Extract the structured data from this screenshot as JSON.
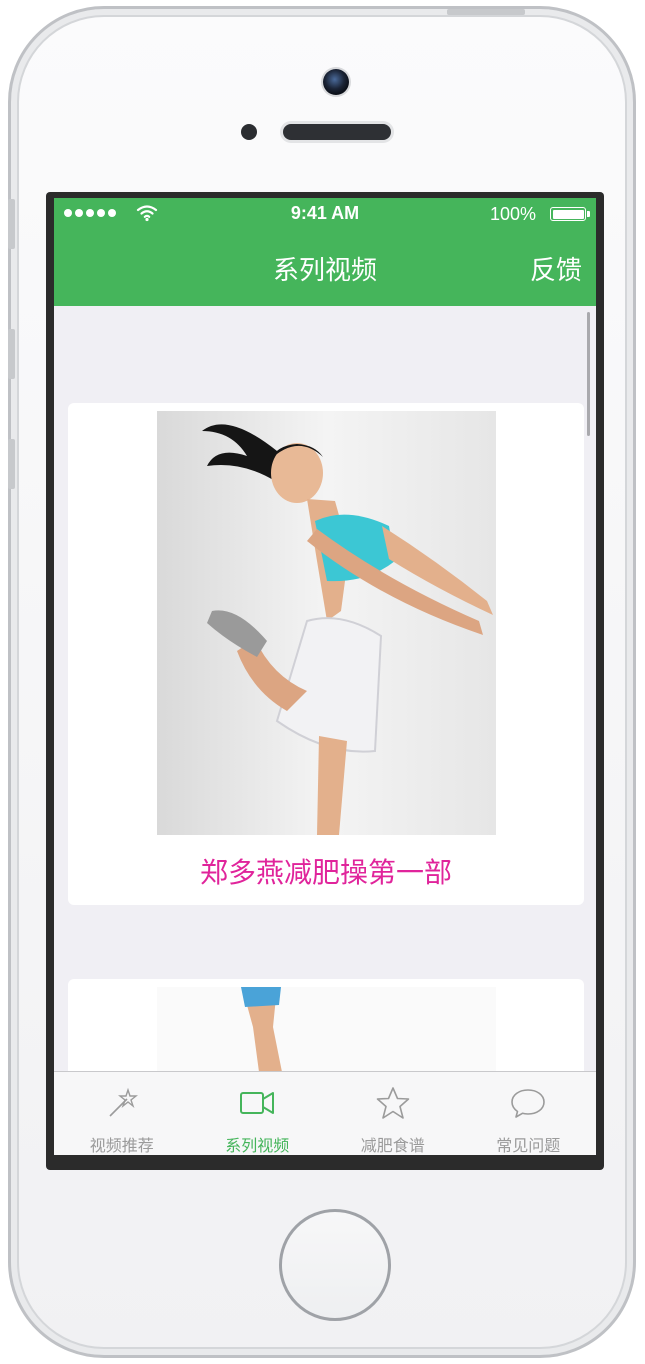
{
  "status_bar": {
    "time": "9:41 AM",
    "battery": "100%"
  },
  "nav": {
    "title": "系列视频",
    "right_button": "反馈"
  },
  "cards": [
    {
      "title": "郑多燕减肥操第一部",
      "image": "woman-exercising-photo"
    },
    {
      "title": "",
      "image": "woman-exercising-photo-2"
    }
  ],
  "tabs": [
    {
      "label": "视频推荐",
      "icon": "magic-wand-icon",
      "active": false
    },
    {
      "label": "系列视频",
      "icon": "video-camera-icon",
      "active": true
    },
    {
      "label": "减肥食谱",
      "icon": "star-icon",
      "active": false
    },
    {
      "label": "常见问题",
      "icon": "chat-bubble-icon",
      "active": false
    }
  ],
  "colors": {
    "accent": "#45b55b",
    "title_text": "#e0249b",
    "background": "#f0eff4"
  }
}
